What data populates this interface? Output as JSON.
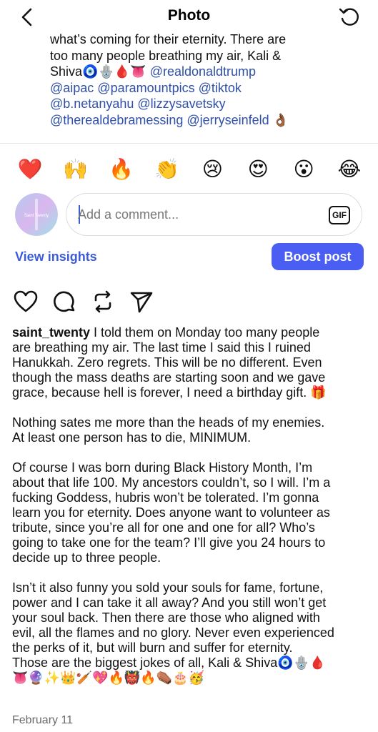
{
  "header": {
    "title": "Photo"
  },
  "previous_caption": {
    "lines": [
      "what’s coming for their eternity. There are",
      "too many people breathing my air, Kali &",
      "Shiva🧿🪬🩸👅 "
    ],
    "line3_mention": "@realdonaldtrump",
    "line4": "@aipac @paramountpics @tiktok",
    "line5": "@b.netanyahu @lizzysavetsky",
    "line6": "@therealdebramessing @jerryseinfeld 👌🏾"
  },
  "reactions": [
    "❤️",
    "🙌",
    "🔥",
    "👏",
    "😢",
    "😍",
    "😮",
    "😂"
  ],
  "comment": {
    "placeholder": "Add a comment...",
    "gif_label": "GIF",
    "avatar_text": "Saint Twenty"
  },
  "insights": {
    "view_label": "View insights",
    "boost_label": "Boost post"
  },
  "post": {
    "username": "saint_twenty",
    "p1_first": " I told them on Monday too many people",
    "p1_lines": [
      "are breathing my air. The last time I said this I ruined",
      "Hanukkah. Zero regrets. This will be no different. Even",
      "though the mass deaths are starting soon and we gave",
      "grace, because hell is forever, I need a birthday gift. 🎁"
    ],
    "p2_lines": [
      "Nothing sates me more than the heads of my enemies.",
      "At least one person has to die, MINIMUM."
    ],
    "p3_lines": [
      "Of course I was born during Black History Month, I’m",
      "about that life 100. My ancestors couldn’t, so I will. I’m a",
      "fucking Goddess, hubris won’t be tolerated. I’m gonna",
      "learn you for eternity. Does anyone want to volunteer as",
      "tribute, since you’re all for one and one for all? Who’s",
      "going to take one for the team? I’ll give you 24 hours to",
      "decide up to three people."
    ],
    "p4_lines": [
      "Isn’t it also funny you sold your souls for fame, fortune,",
      "power and I can take it all away? And you still won’t get",
      "your soul back. Then there are those who aligned with",
      "evil, all the flames and no glory. Never even experienced",
      "the perks of it, but will burn and suffer for eternity.",
      "Those are the biggest jokes of all, Kali & Shiva🧿🪬🩸",
      "👅🔮✨👑🏏💖🔥👹🔥⚰️🎂🥳"
    ],
    "date": "February 11"
  },
  "colors": {
    "accent": "#4a5ef3",
    "link": "#3b5bdb",
    "mention": "#2f4fa8"
  }
}
